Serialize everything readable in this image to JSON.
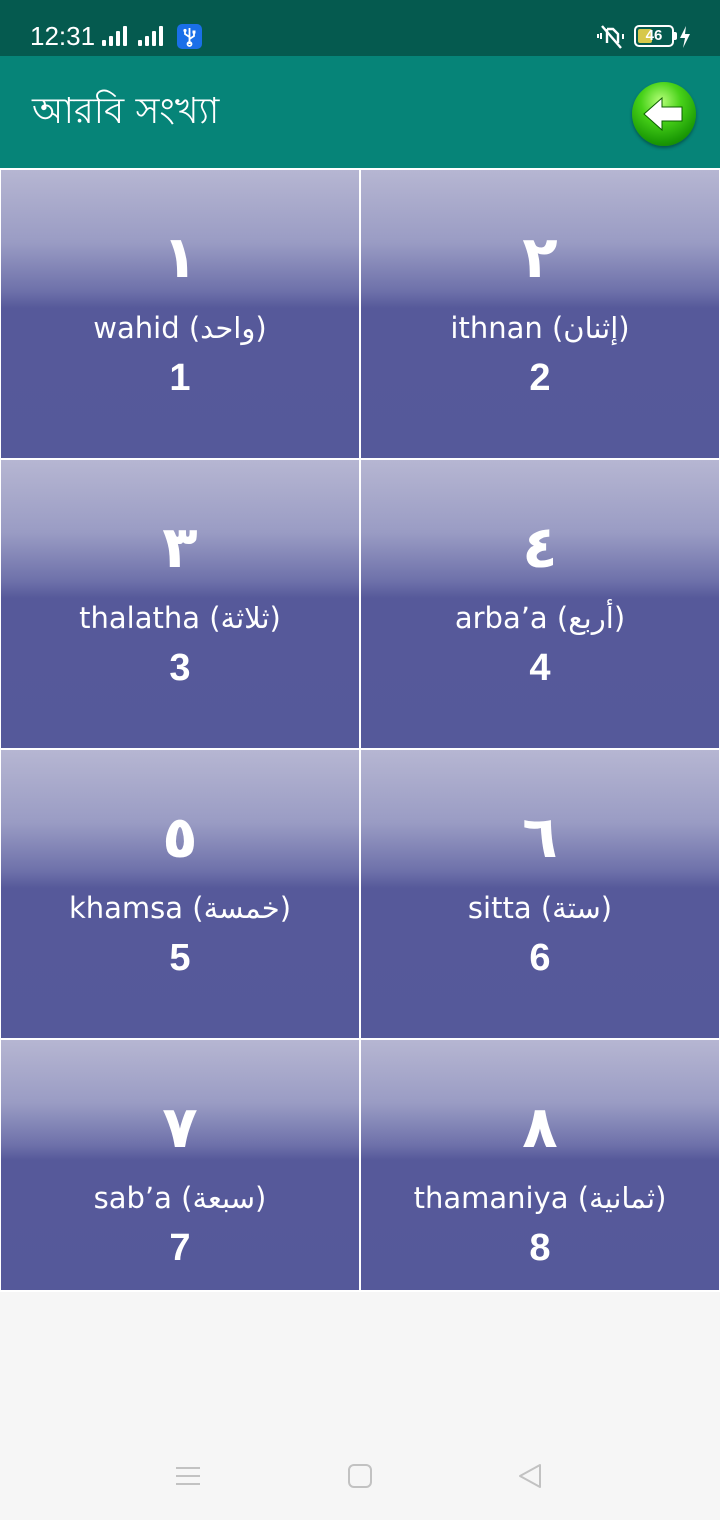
{
  "status": {
    "time": "12:31",
    "battery_level": "46"
  },
  "appbar": {
    "title": "আরবি সংখ্যা"
  },
  "numbers": [
    {
      "arabic": "١",
      "translit": "wahid (واحد)",
      "digit": "1"
    },
    {
      "arabic": "٢",
      "translit": "ithnan (إثنان)",
      "digit": "2"
    },
    {
      "arabic": "٣",
      "translit": "thalatha (ثلاثة)",
      "digit": "3"
    },
    {
      "arabic": "٤",
      "translit": "arba’a (أربع)",
      "digit": "4"
    },
    {
      "arabic": "٥",
      "translit": "khamsa (خمسة)",
      "digit": "5"
    },
    {
      "arabic": "٦",
      "translit": "sitta (ستة)",
      "digit": "6"
    },
    {
      "arabic": "٧",
      "translit": "sab’a (سبعة)",
      "digit": "7"
    },
    {
      "arabic": "٨",
      "translit": "thamaniya (ثمانية)",
      "digit": "8"
    }
  ],
  "icons": {
    "back": "back-arrow-icon",
    "usb": "usb-icon",
    "mute": "vibrate-off-icon",
    "battery": "battery-icon",
    "charging": "charging-bolt-icon",
    "nav_menu": "menu-icon",
    "nav_home": "home-icon",
    "nav_back": "back-icon"
  },
  "colors": {
    "statusbar": "#055a4f",
    "appbar": "#068478",
    "tile_top": "#b6b6d2",
    "tile_bottom": "#55599a",
    "back_button": "#1b9a05"
  }
}
